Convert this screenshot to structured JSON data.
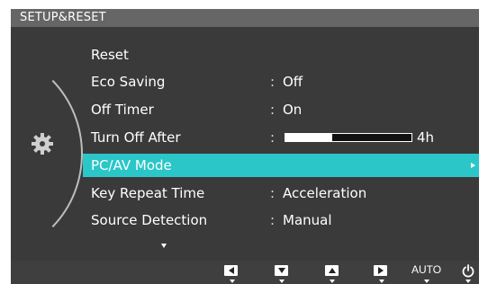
{
  "menu": {
    "title": "SETUP&RESET",
    "items": [
      {
        "label": "Reset",
        "value": ""
      },
      {
        "label": "Eco Saving",
        "value": "Off"
      },
      {
        "label": "Off Timer",
        "value": "On"
      },
      {
        "label": "Turn Off After",
        "value": "4h",
        "progress": 0.37
      },
      {
        "label": "PC/AV Mode",
        "value": "",
        "selected": true
      },
      {
        "label": "Key Repeat Time",
        "value": "Acceleration"
      },
      {
        "label": "Source Detection",
        "value": "Manual"
      }
    ],
    "colon": ":"
  },
  "keys": {
    "auto_label": "AUTO"
  },
  "colors": {
    "highlight": "#2bc6c8",
    "panel": "#3a3a3a",
    "title_bar": "#666666"
  },
  "icons": {
    "category": "gear-icon",
    "left": "left-triangle-icon",
    "down": "down-triangle-icon",
    "up": "up-triangle-icon",
    "enter": "right-triangle-icon",
    "power": "power-icon"
  }
}
